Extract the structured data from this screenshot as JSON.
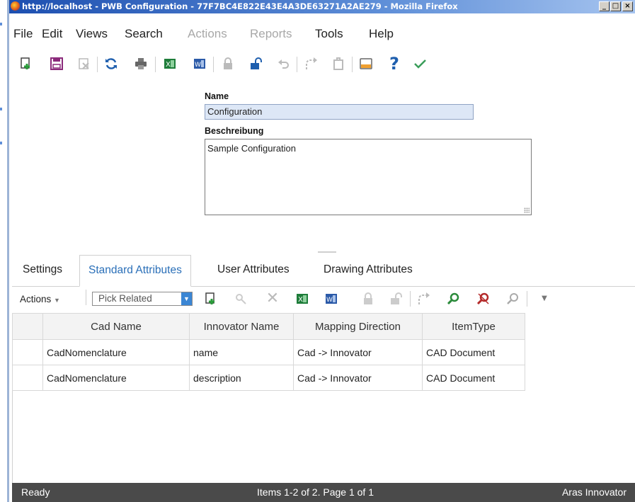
{
  "window": {
    "title": "http://localhost - PWB Configuration - 77F7BC4E822E43E4A3DE63271A2AE279 - Mozilla Firefox",
    "controls": [
      "_",
      "□",
      "×"
    ]
  },
  "menu": {
    "items": [
      {
        "label": "File",
        "enabled": true
      },
      {
        "label": "Edit",
        "enabled": true
      },
      {
        "label": "Views",
        "enabled": true
      },
      {
        "label": "Search",
        "enabled": true
      },
      {
        "label": "Actions",
        "enabled": false
      },
      {
        "label": "Reports",
        "enabled": false
      },
      {
        "label": "Tools",
        "enabled": true
      },
      {
        "label": "Help",
        "enabled": true
      }
    ]
  },
  "toolbar": {
    "icons": [
      "new-icon",
      "save-icon",
      "discard-icon",
      "refresh-icon",
      "print-icon",
      "excel-icon",
      "word-icon",
      "lock-icon",
      "unlock-icon",
      "undo-icon",
      "promote-icon",
      "claim-icon",
      "panel-icon",
      "help-icon",
      "done-icon"
    ]
  },
  "form": {
    "name_label": "Name",
    "name_value": "Configuration",
    "description_label": "Beschreibung",
    "description_value": "Sample Configuration"
  },
  "tabs": [
    {
      "label": "Settings",
      "active": false
    },
    {
      "label": "Standard Attributes",
      "active": true
    },
    {
      "label": "User Attributes",
      "active": false
    },
    {
      "label": "Drawing Attributes",
      "active": false
    }
  ],
  "relationship_toolbar": {
    "actions_label": "Actions",
    "pick_related": "Pick Related"
  },
  "grid": {
    "columns": [
      "Cad Name",
      "Innovator Name",
      "Mapping Direction",
      "ItemType"
    ],
    "rows": [
      [
        "CadNomenclature",
        "name",
        "Cad -> Innovator",
        "CAD Document"
      ],
      [
        "CadNomenclature",
        "description",
        "Cad -> Innovator",
        "CAD Document"
      ]
    ]
  },
  "status": {
    "left": "Ready",
    "center": "Items 1-2 of 2. Page 1 of 1",
    "right": "Aras Innovator"
  },
  "colors": {
    "accent": "#2a6fb8",
    "status_bar": "#4a4a4a",
    "name_field_bg": "#dde7f6"
  }
}
